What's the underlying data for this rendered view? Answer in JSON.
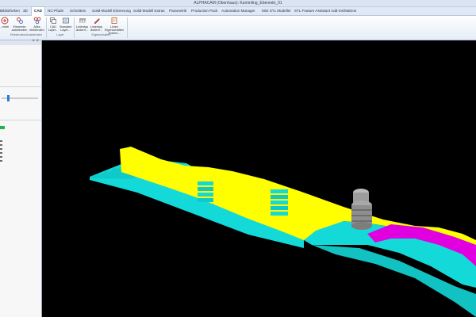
{
  "window": {
    "title": "ALPHACAM (Obenhaus): Kummling_Ebenedo_01"
  },
  "tabs": [
    {
      "label": "Bibliotheken"
    },
    {
      "label": "3D"
    },
    {
      "label": "CAD"
    },
    {
      "label": "NC-Pfade"
    },
    {
      "label": "Schnittein"
    },
    {
      "label": "Solid-Modell Erkennung"
    },
    {
      "label": "Solid-Modell Extras"
    },
    {
      "label": "Parametrik"
    },
    {
      "label": "Production Pack"
    },
    {
      "label": "Automation Manager"
    },
    {
      "label": "Mini STL Modeller"
    },
    {
      "label": "STL Feature Assistant"
    },
    {
      "label": "Add-Ins/Makros"
    }
  ],
  "ribbon": {
    "buttons": [
      {
        "label": "...estel"
      },
      {
        "label": "Elemente ausblenden"
      },
      {
        "label": "Alles einblenden"
      },
      {
        "label": "CAD Layer..."
      },
      {
        "label": "Standard Layer..."
      },
      {
        "label": "Linientyp ändern..."
      },
      {
        "label": "Linientyp ändern..."
      },
      {
        "label": "Linien Eigenschaften ändern..."
      }
    ],
    "groups": [
      {
        "label": "Einblenden/Ausblenden"
      },
      {
        "label": "Layer"
      },
      {
        "label": "Eigenschaften"
      }
    ]
  },
  "left_panel": {
    "close_glyph": "× ×"
  },
  "colors": {
    "viewport_bg": "#000000",
    "model_yellow": "#ffff00",
    "model_cyan": "#14d9d9",
    "model_magenta": "#e000e0",
    "tool_gray": "#9c9c9c"
  }
}
